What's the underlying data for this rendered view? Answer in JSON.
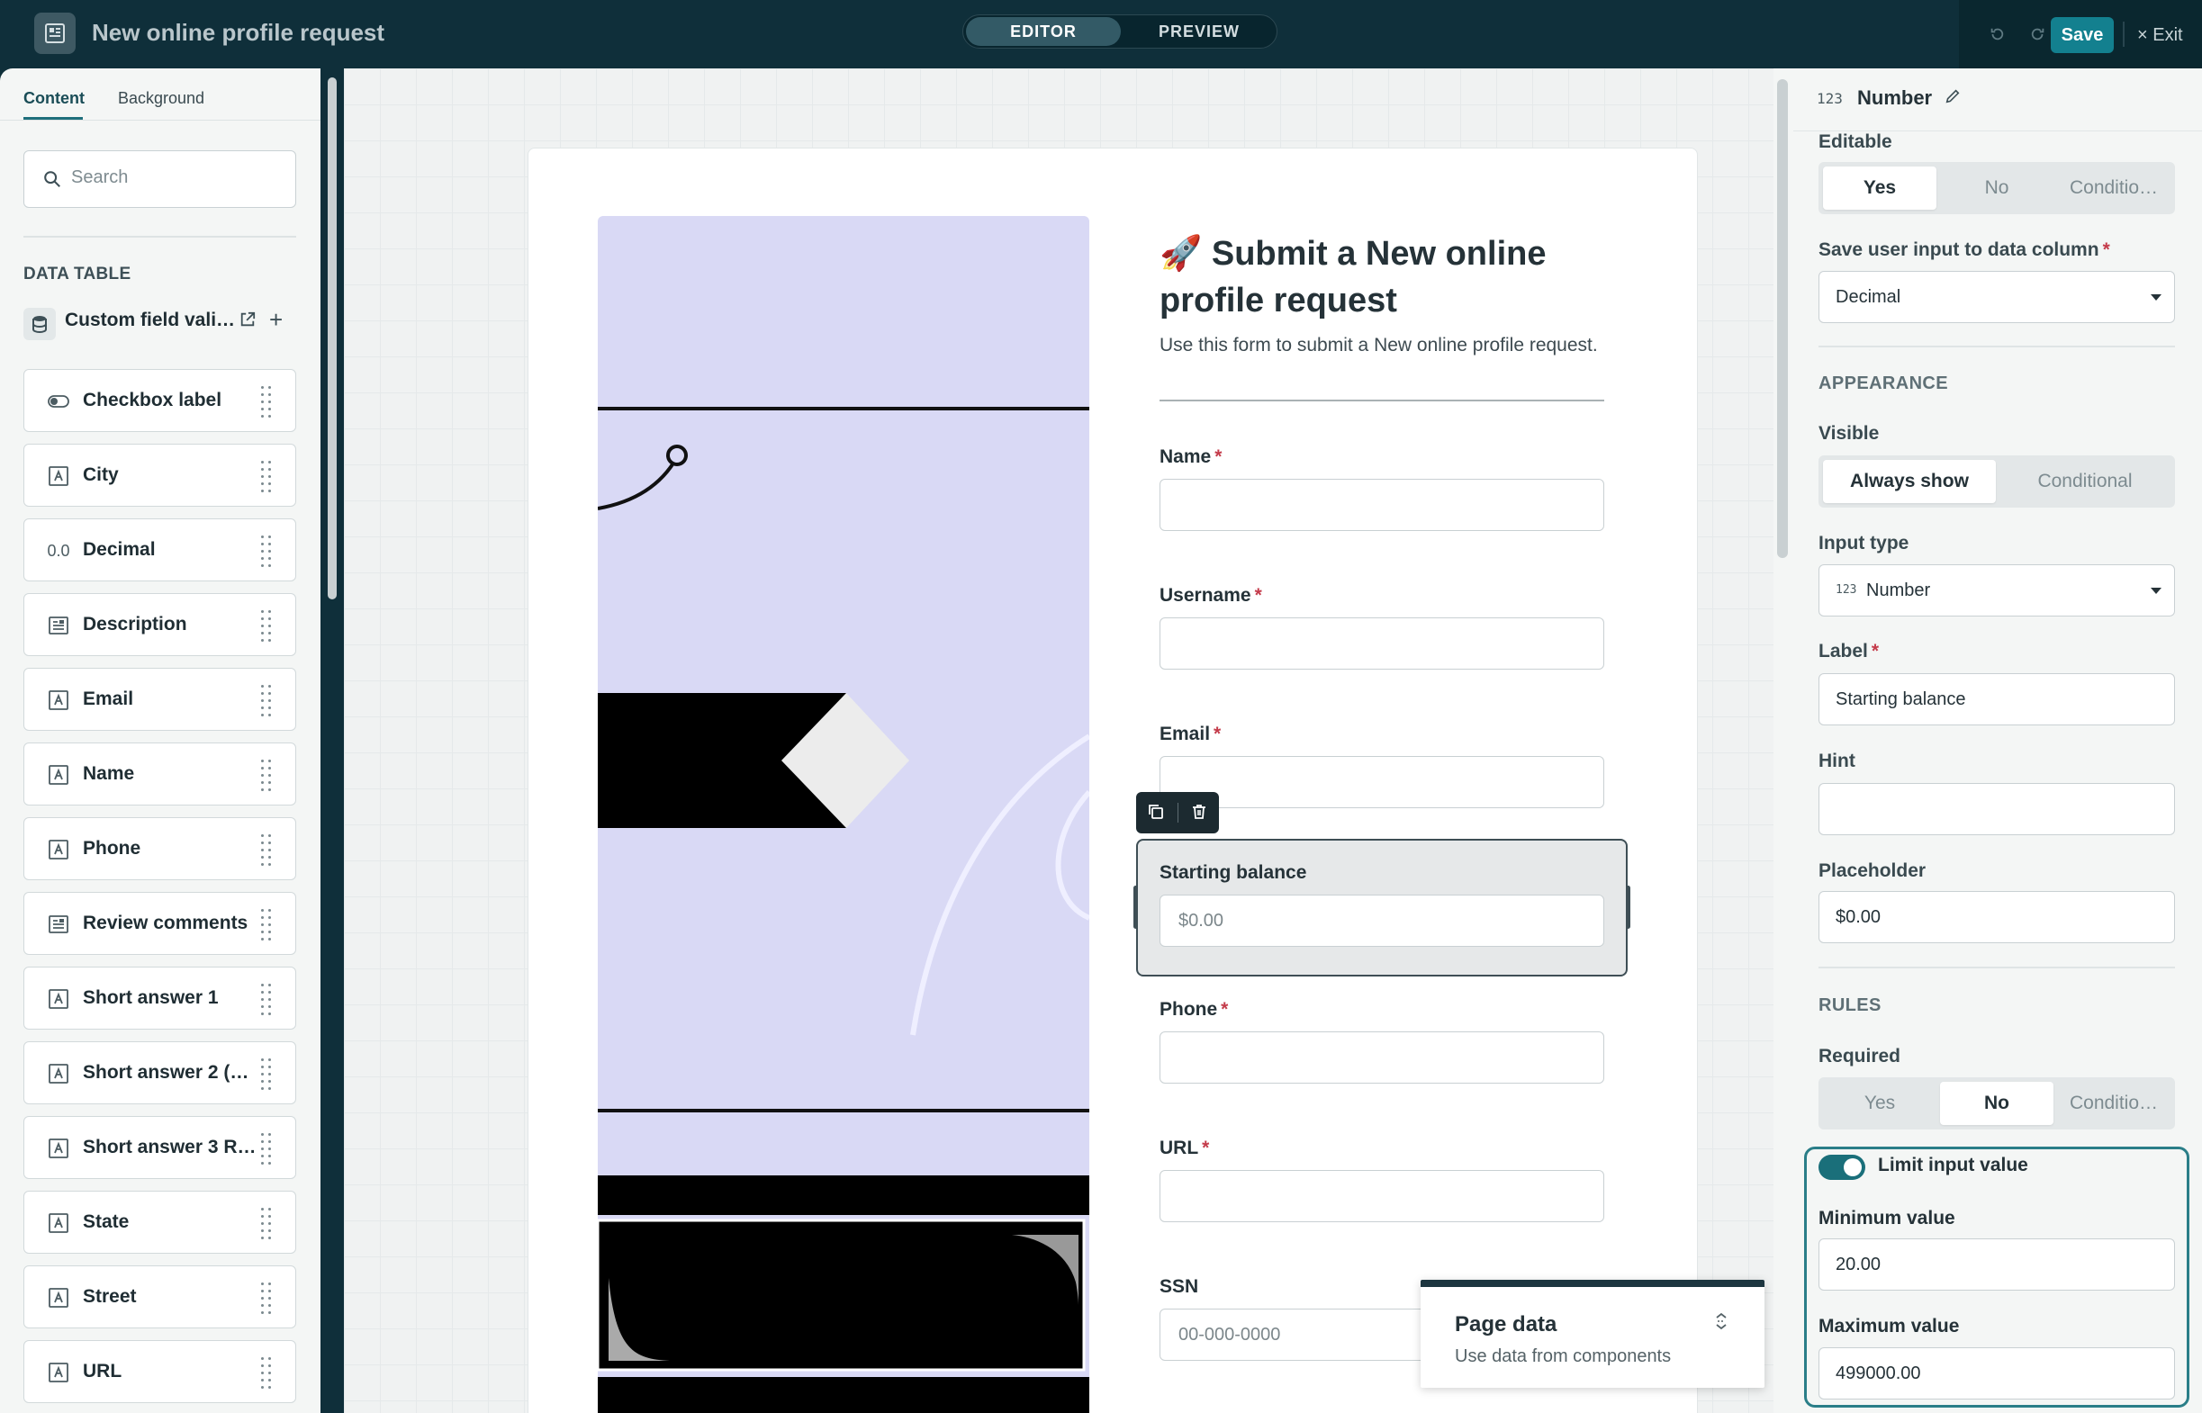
{
  "topbar": {
    "title": "New online profile request",
    "mode_editor": "EDITOR",
    "mode_preview": "PREVIEW",
    "save_label": "Save",
    "exit_label": "Exit"
  },
  "left_panel": {
    "tabs": [
      "Content",
      "Background"
    ],
    "search_placeholder": "Search",
    "data_table_heading": "DATA TABLE",
    "data_table_name": "Custom field vali…",
    "fields": [
      {
        "label": "Checkbox label",
        "icon": "toggle-icon"
      },
      {
        "label": "City",
        "icon": "text-field-icon"
      },
      {
        "label": "Decimal",
        "icon": "decimal-icon",
        "icon_text": "0.0"
      },
      {
        "label": "Description",
        "icon": "long-text-icon"
      },
      {
        "label": "Email",
        "icon": "text-field-icon"
      },
      {
        "label": "Name",
        "icon": "text-field-icon"
      },
      {
        "label": "Phone",
        "icon": "text-field-icon"
      },
      {
        "label": "Review comments",
        "icon": "long-text-icon"
      },
      {
        "label": "Short answer 1",
        "icon": "text-field-icon"
      },
      {
        "label": "Short answer 2 (…",
        "icon": "text-field-icon"
      },
      {
        "label": "Short answer 3 R…",
        "icon": "text-field-icon"
      },
      {
        "label": "State",
        "icon": "text-field-icon"
      },
      {
        "label": "Street",
        "icon": "text-field-icon"
      },
      {
        "label": "URL",
        "icon": "text-field-icon"
      }
    ]
  },
  "form": {
    "title": "🚀 Submit a New online profile request",
    "subtitle": "Use this form to submit a New online profile request.",
    "fields": {
      "name": {
        "label": "Name",
        "required": "*"
      },
      "username": {
        "label": "Username",
        "required": "*"
      },
      "email": {
        "label": "Email",
        "required": "*"
      },
      "starting_balance": {
        "label": "Starting balance",
        "placeholder": "$0.00"
      },
      "phone": {
        "label": "Phone",
        "required": "*"
      },
      "url": {
        "label": "URL",
        "required": "*"
      },
      "ssn": {
        "label": "SSN",
        "placeholder": "00-000-0000"
      }
    }
  },
  "page_data_panel": {
    "title": "Page data",
    "subtitle": "Use data from components"
  },
  "right_panel": {
    "component_icon_text": "123",
    "component_title": "Number",
    "editable_label": "Editable",
    "editable_options": [
      "Yes",
      "No",
      "Conditio…"
    ],
    "editable_selected": "Yes",
    "save_column_label": "Save user input to data column",
    "save_column_value": "Decimal",
    "appearance_heading": "APPEARANCE",
    "visible_label": "Visible",
    "visible_options": [
      "Always show",
      "Conditional"
    ],
    "visible_selected": "Always show",
    "input_type_label": "Input type",
    "input_type_value": "Number",
    "label_label": "Label",
    "label_value": "Starting balance",
    "hint_label": "Hint",
    "hint_value": "",
    "placeholder_label": "Placeholder",
    "placeholder_value": "$0.00",
    "rules_heading": "RULES",
    "required_label": "Required",
    "required_options": [
      "Yes",
      "No",
      "Conditio…"
    ],
    "required_selected": "No",
    "limit_label": "Limit input value",
    "limit_enabled": true,
    "min_label": "Minimum value",
    "min_value": "20.00",
    "max_label": "Maximum value",
    "max_value": "499000.00",
    "required_star": "*"
  },
  "colors": {
    "topbar_bg": "#0f2f3a",
    "accent": "#13808f",
    "required_star": "#c43b4a",
    "hero_bg": "#d9d9f5"
  }
}
